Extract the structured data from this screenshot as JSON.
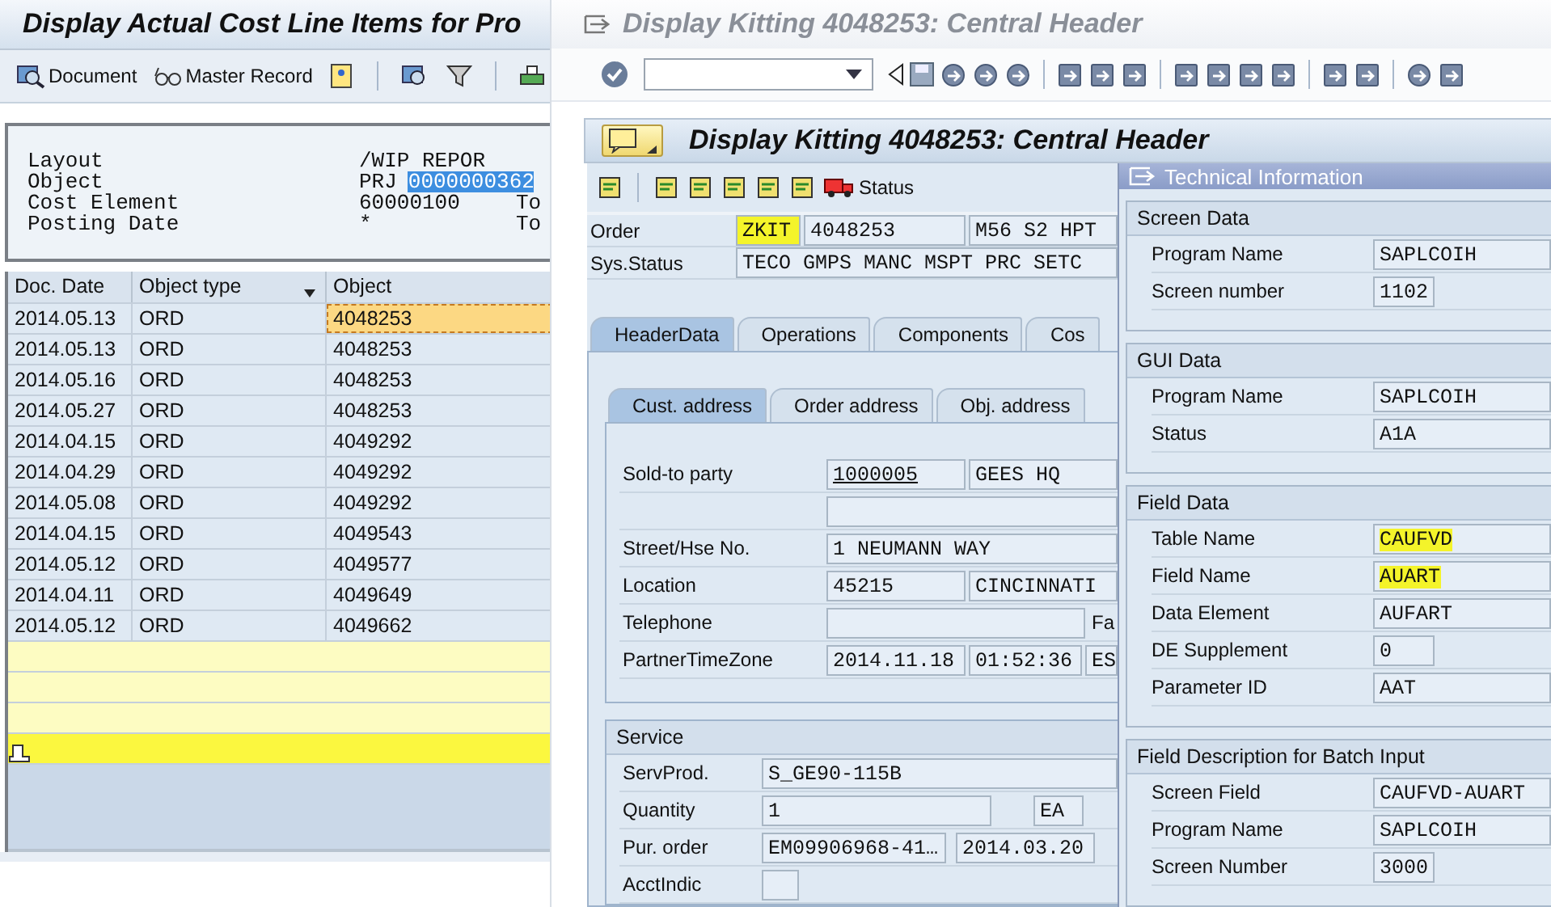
{
  "cost_window": {
    "title": "Display Actual Cost Line Items for Pro",
    "toolbar": [
      {
        "label": "Document",
        "kind": "document"
      },
      {
        "label": "Master Record",
        "kind": "glasses"
      }
    ],
    "header": [
      {
        "label": "Layout",
        "value": "/WIP REPOR"
      },
      {
        "label": "Object",
        "value": "PRJ",
        "selection": "0000000362"
      },
      {
        "label": "Cost Element",
        "value": "60000100",
        "to": "To"
      },
      {
        "label": "Posting Date",
        "value": "*",
        "to": "To"
      }
    ],
    "table": {
      "columns": [
        "Doc. Date",
        "Object type",
        "Object"
      ],
      "rows": [
        {
          "cells": [
            "2014.05.13",
            "ORD",
            "4048253"
          ],
          "selected": true
        },
        {
          "cells": [
            "2014.05.13",
            "ORD",
            "4048253"
          ],
          "selected": false
        },
        {
          "cells": [
            "2014.05.16",
            "ORD",
            "4048253"
          ],
          "selected": false
        },
        {
          "cells": [
            "2014.05.27",
            "ORD",
            "4048253"
          ],
          "selected": false
        },
        {
          "cells": [
            "2014.04.15",
            "ORD",
            "4049292"
          ],
          "selected": false
        },
        {
          "cells": [
            "2014.04.29",
            "ORD",
            "4049292"
          ],
          "selected": false
        },
        {
          "cells": [
            "2014.05.08",
            "ORD",
            "4049292"
          ],
          "selected": false
        },
        {
          "cells": [
            "2014.04.15",
            "ORD",
            "4049543"
          ],
          "selected": false
        },
        {
          "cells": [
            "2014.05.12",
            "ORD",
            "4049577"
          ],
          "selected": false
        },
        {
          "cells": [
            "2014.04.11",
            "ORD",
            "4049649"
          ],
          "selected": false
        },
        {
          "cells": [
            "2014.05.12",
            "ORD",
            "4049662"
          ],
          "selected": false
        }
      ]
    }
  },
  "kitting_window": {
    "title": "Display Kitting 4048253: Central Header",
    "inner_title": "Display Kitting 4048253: Central Header",
    "status_button": "Status",
    "order": {
      "label": "Order",
      "type": "ZKIT",
      "type_highlighted": true,
      "number": "4048253",
      "description": "M56 S2 HPT"
    },
    "sys_status": {
      "label": "Sys.Status",
      "value": "TECO  GMPS  MANC  MSPT  PRC   SETC"
    },
    "tabs": [
      {
        "label": "HeaderData",
        "selected": true
      },
      {
        "label": "Operations",
        "selected": false
      },
      {
        "label": "Components",
        "selected": false
      },
      {
        "label": "Cos",
        "selected": false
      }
    ],
    "subtabs": [
      {
        "label": "Cust. address",
        "selected": true
      },
      {
        "label": "Order address",
        "selected": false
      },
      {
        "label": "Obj. address",
        "selected": false
      }
    ],
    "address_rows": [
      {
        "label": "Sold-to party",
        "values": [
          {
            "kind": "link",
            "text": "1000005"
          },
          {
            "kind": "wide",
            "text": "GEES HQ"
          }
        ]
      },
      {
        "values": [
          {
            "kind": "blank"
          }
        ]
      },
      {
        "label": "Street/Hse No.",
        "values": [
          {
            "kind": "wide",
            "text": "1 NEUMANN WAY"
          }
        ]
      },
      {
        "label": "Location",
        "values": [
          {
            "kind": "code",
            "text": "45215"
          },
          {
            "kind": "wide",
            "text": "CINCINNATI"
          }
        ]
      },
      {
        "label": "Telephone",
        "values": [
          {
            "kind": "phone"
          },
          {
            "kind": "label",
            "text": "Fa"
          }
        ]
      },
      {
        "label": "PartnerTimeZone",
        "values": [
          {
            "kind": "code",
            "text": "2014.11.18"
          },
          {
            "kind": "time",
            "text": "01:52:36"
          },
          {
            "kind": "wide",
            "text": "ES"
          }
        ]
      }
    ],
    "service": {
      "title": "Service",
      "rows": [
        {
          "label": "ServProd.",
          "values": [
            {
              "kind": "wide",
              "text": "S_GE90-115B"
            }
          ]
        },
        {
          "label": "Quantity",
          "values": [
            {
              "kind": "qty",
              "text": "1"
            },
            {
              "kind": "unit",
              "text": "EA"
            }
          ]
        },
        {
          "label": "Pur. order",
          "values": [
            {
              "kind": "po",
              "text": "EM09906968-41…"
            },
            {
              "kind": "date",
              "text": "2014.03.20"
            }
          ]
        },
        {
          "label": "AcctIndic",
          "values": [
            {
              "kind": "small"
            }
          ]
        }
      ]
    }
  },
  "technical_info": {
    "title": "Technical Information",
    "sections": [
      {
        "title": "Screen Data",
        "rows": [
          {
            "label": "Program Name",
            "value": "SAPLCOIH",
            "kind": "wide",
            "highlighted": false
          },
          {
            "label": "Screen number",
            "value": "1102",
            "kind": "short",
            "highlighted": false
          }
        ]
      },
      {
        "title": "GUI Data",
        "rows": [
          {
            "label": "Program Name",
            "value": "SAPLCOIH",
            "kind": "wide",
            "highlighted": false
          },
          {
            "label": "Status",
            "value": "A1A",
            "kind": "wide",
            "highlighted": false
          }
        ]
      },
      {
        "title": "Field Data",
        "rows": [
          {
            "label": "Table Name",
            "value": "CAUFVD",
            "kind": "wide",
            "highlighted": true
          },
          {
            "label": "Field Name",
            "value": "AUART",
            "kind": "wide",
            "highlighted": true
          },
          {
            "label": "Data Element",
            "value": "AUFART",
            "kind": "wide",
            "highlighted": false
          },
          {
            "label": "DE Supplement",
            "value": "0",
            "kind": "short",
            "highlighted": false
          },
          {
            "label": "Parameter ID",
            "value": "AAT",
            "kind": "wide",
            "highlighted": false
          }
        ]
      },
      {
        "title": "Field Description for Batch Input",
        "rows": [
          {
            "label": "Screen Field",
            "value": "CAUFVD-AUART",
            "kind": "wide",
            "highlighted": false
          },
          {
            "label": "Program Name",
            "value": "SAPLCOIH",
            "kind": "wide",
            "highlighted": false
          },
          {
            "label": "Screen Number",
            "value": "3000",
            "kind": "short",
            "highlighted": false
          }
        ]
      }
    ]
  }
}
